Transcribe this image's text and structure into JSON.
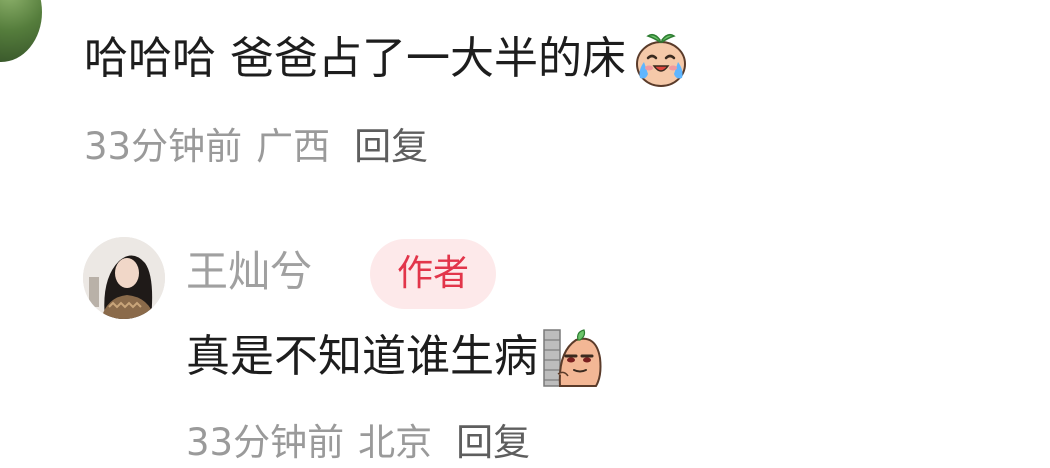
{
  "comment": {
    "text": "哈哈哈 爸爸占了一大半的床",
    "emoji_icon": "crying-laugh-egg-emoji-icon",
    "time": "33分钟前",
    "location": "广西",
    "reply_label": "回复"
  },
  "reply": {
    "author_name": "王灿兮",
    "author_badge": "作者",
    "text": "真是不知道谁生病",
    "emoji_icon": "peeking-wall-egg-emoji-icon",
    "time": "33分钟前",
    "location": "北京",
    "reply_label": "回复"
  },
  "colors": {
    "badge_bg": "#fde9ea",
    "badge_text": "#e2354a",
    "meta_text": "#9a9a9a",
    "body_text": "#1d1d1d"
  }
}
